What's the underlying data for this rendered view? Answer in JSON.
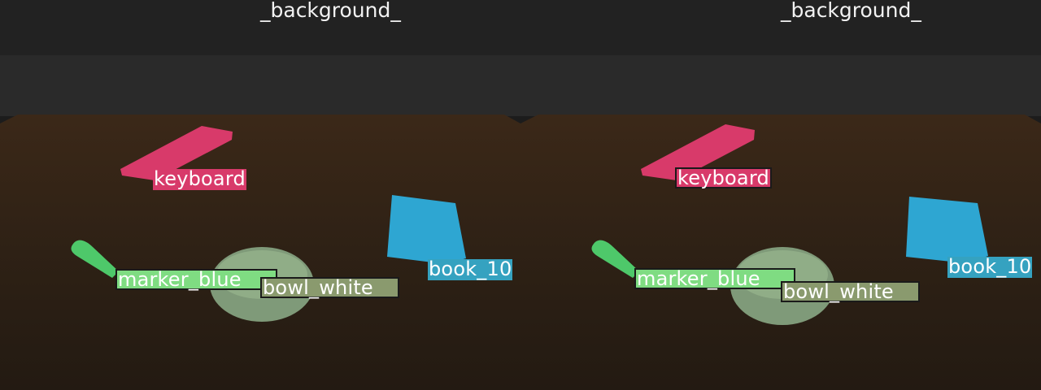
{
  "panels": [
    {
      "background_label": "_background_",
      "labels": {
        "keyboard": "keyboard",
        "marker": "marker_blue",
        "bowl": "bowl_white",
        "book": "book_10"
      }
    },
    {
      "background_label": "_background_",
      "labels": {
        "keyboard": "keyboard",
        "marker": "marker_blue",
        "bowl": "bowl_white",
        "book": "book_10"
      }
    }
  ],
  "colors": {
    "sky_top": "#232323",
    "sky_bottom": "#2c2c2c",
    "wall": "#252525",
    "table": "#2f2216",
    "keyboard": "#d83a6a",
    "marker": "#4ec86a",
    "marker_label_bg": "#7fdc82",
    "bowl": "#8aa583",
    "bowl_label_bg": "#8a9a6e",
    "book": "#2ea6d2",
    "book_label_bg": "#35a2c0"
  }
}
